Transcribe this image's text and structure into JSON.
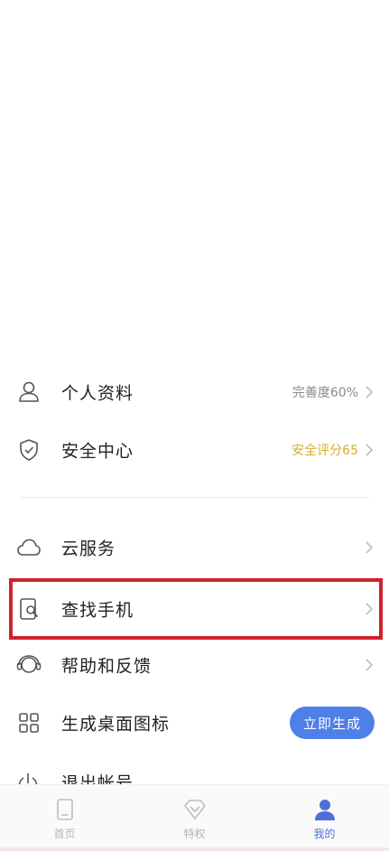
{
  "menu": {
    "profile": {
      "label": "个人资料",
      "meta": "完善度60%",
      "icon": "person-icon"
    },
    "security": {
      "label": "安全中心",
      "meta": "安全评分65",
      "icon": "shield-check-icon"
    },
    "cloud": {
      "label": "云服务",
      "icon": "cloud-icon"
    },
    "find_phone": {
      "label": "查找手机",
      "icon": "find-phone-icon"
    },
    "help": {
      "label": "帮助和反馈",
      "icon": "headset-icon"
    },
    "shortcut": {
      "label": "生成桌面图标",
      "button": "立即生成",
      "icon": "grid-icon"
    },
    "logout": {
      "label": "退出帐号",
      "icon": "power-icon"
    }
  },
  "tabbar": {
    "tabs": [
      {
        "label": "首页",
        "icon": "phone-home-icon",
        "active": false
      },
      {
        "label": "特权",
        "icon": "diamond-icon",
        "active": false
      },
      {
        "label": "我的",
        "icon": "user-icon",
        "active": true
      }
    ]
  },
  "colors": {
    "accent": "#4f7fe8",
    "score_gold": "#d4b02a",
    "highlight_red": "#d0212b",
    "active_tab": "#4f6fd8"
  }
}
